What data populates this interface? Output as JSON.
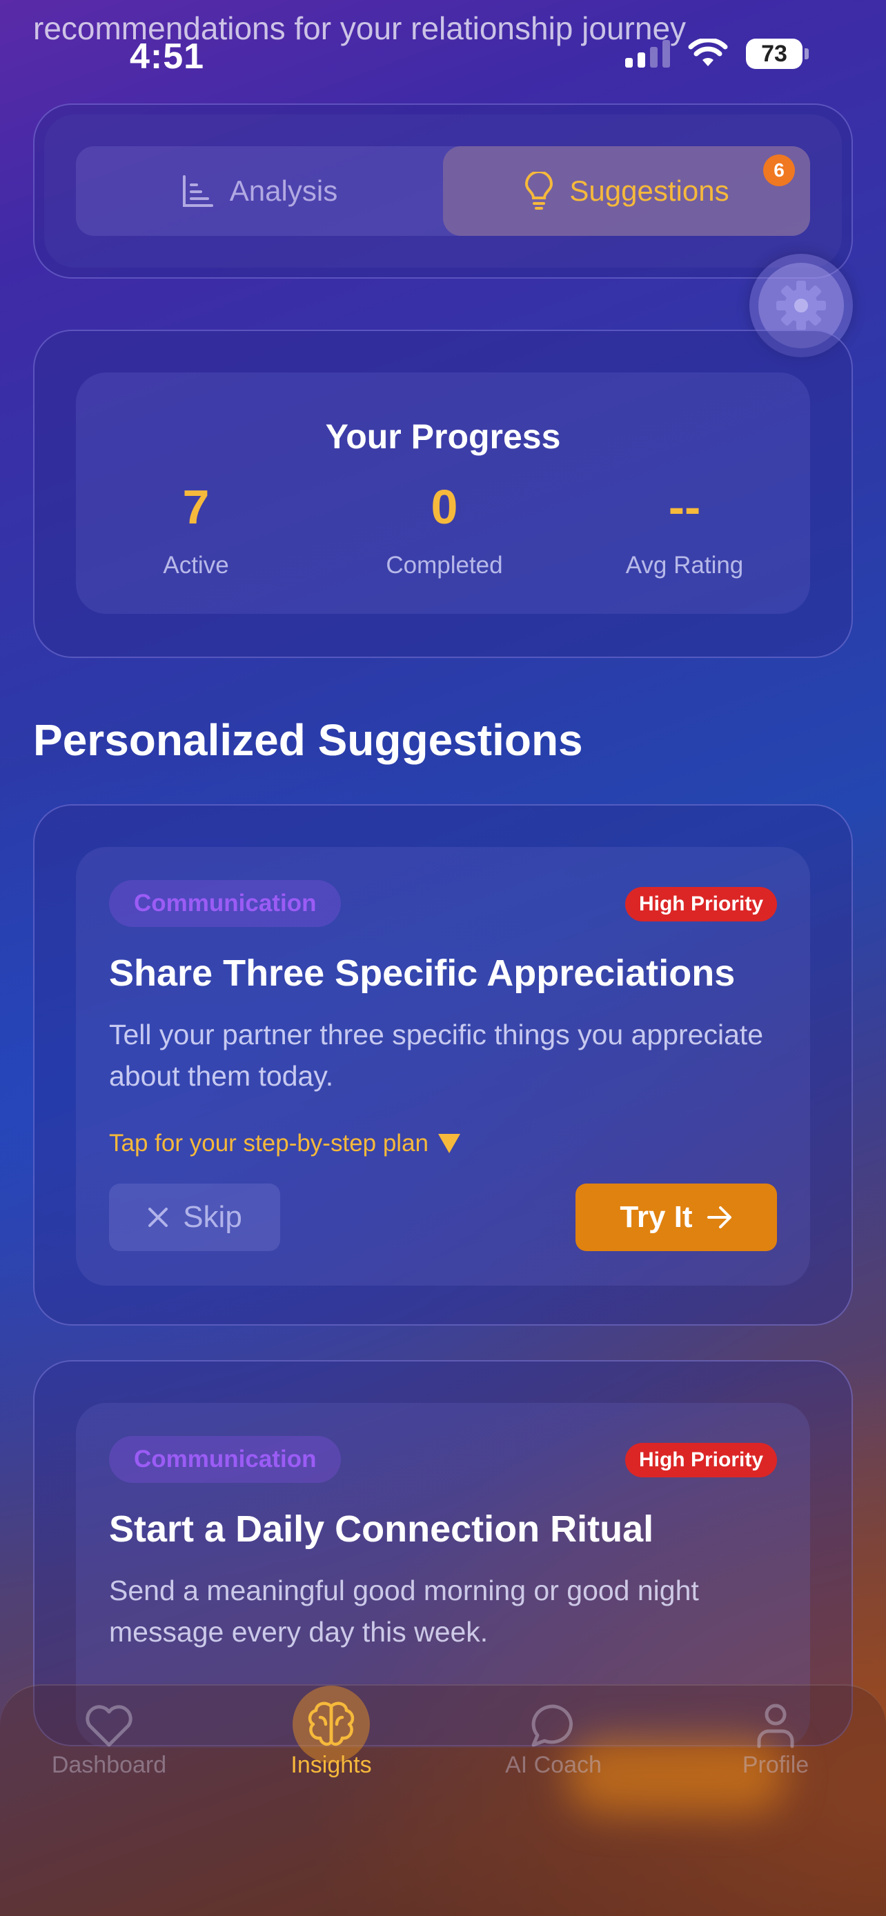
{
  "header": {
    "subtitle": "recommendations for your relationship journey",
    "time": "4:51",
    "battery": "73"
  },
  "tabs": [
    {
      "label": "Analysis",
      "icon": "bar-chart-icon",
      "active": false
    },
    {
      "label": "Suggestions",
      "icon": "lightbulb-icon",
      "active": true,
      "badge": "6"
    }
  ],
  "progress": {
    "title": "Your Progress",
    "stats": [
      {
        "value": "7",
        "label": "Active"
      },
      {
        "value": "0",
        "label": "Completed"
      },
      {
        "value": "--",
        "label": "Avg Rating"
      }
    ]
  },
  "section_title": "Personalized Suggestions",
  "suggestions": [
    {
      "category": "Communication",
      "priority": "High Priority",
      "title": "Share Three Specific Appreciations",
      "description": "Tell your partner three specific things you appreciate about them today.",
      "plan_hint": "Tap for your step-by-step plan",
      "skip_label": "Skip",
      "try_label": "Try It"
    },
    {
      "category": "Communication",
      "priority": "High Priority",
      "title": "Start a Daily Connection Ritual",
      "description": "Send a meaningful good morning or good night message every day this week."
    }
  ],
  "nav": [
    {
      "label": "Dashboard",
      "icon": "heart-icon",
      "active": false
    },
    {
      "label": "Insights",
      "icon": "brain-icon",
      "active": true
    },
    {
      "label": "AI Coach",
      "icon": "chat-bubble-icon",
      "active": false
    },
    {
      "label": "Profile",
      "icon": "user-icon",
      "active": false
    }
  ],
  "colors": {
    "accent": "#f6b93b",
    "try_button": "#e08210",
    "priority": "#dc2626",
    "category": "#9b5cf5"
  }
}
